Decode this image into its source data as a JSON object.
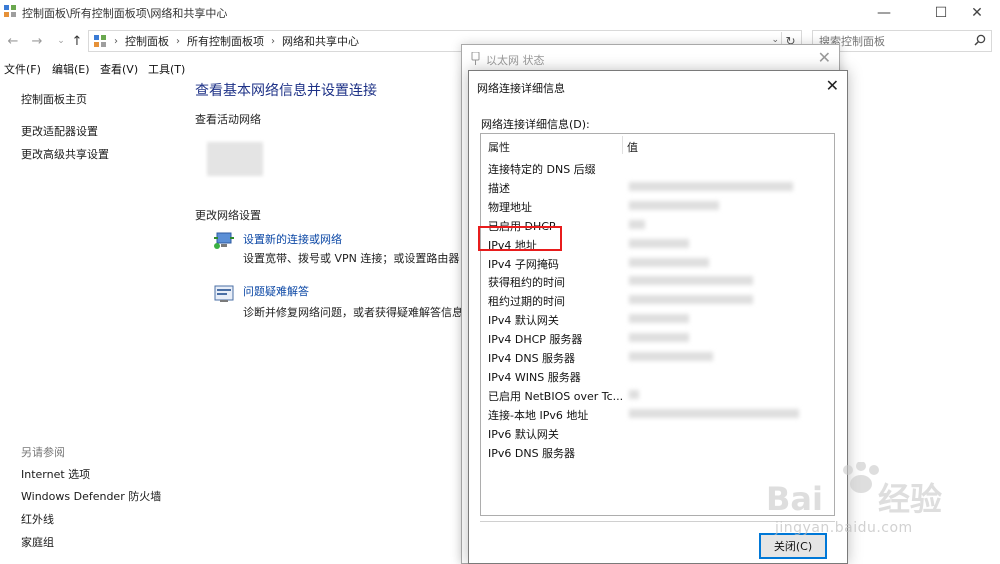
{
  "window": {
    "title": "控制面板\\所有控制面板项\\网络和共享中心",
    "minimize": "—",
    "maximize": "☐",
    "close": "✕"
  },
  "address": {
    "back": "←",
    "forward": "→",
    "up": "↑",
    "crumbs": [
      "控制面板",
      "所有控制面板项",
      "网络和共享中心"
    ],
    "dropdown": "⌄",
    "refresh": "↻",
    "search_placeholder": "搜索控制面板"
  },
  "menubar": [
    "文件(F)",
    "编辑(E)",
    "查看(V)",
    "工具(T)"
  ],
  "sidebar": {
    "home": "控制面板主页",
    "links": [
      "更改适配器设置",
      "更改高级共享设置"
    ],
    "see_also": "另请参阅",
    "see_also_links": [
      "Internet 选项",
      "Windows Defender 防火墙",
      "红外线",
      "家庭组"
    ]
  },
  "main": {
    "title": "查看基本网络信息并设置连接",
    "active_networks": "查看活动网络",
    "change_settings": "更改网络设置",
    "tasks": [
      {
        "link": "设置新的连接或网络",
        "desc": "设置宽带、拨号或 VPN 连接；或设置路由器"
      },
      {
        "link": "问题疑难解答",
        "desc": "诊断并修复网络问题，或者获得疑难解答信息。"
      }
    ]
  },
  "eth_window": {
    "title": "以太网 状态",
    "close": "✕"
  },
  "dialog": {
    "title": "网络连接详细信息",
    "close": "✕",
    "label": "网络连接详细信息(D):",
    "col_property": "属性",
    "col_value": "值",
    "rows": [
      {
        "property": "连接特定的 DNS 后缀",
        "blur": 0
      },
      {
        "property": "描述",
        "blur": 0.82
      },
      {
        "property": "物理地址",
        "blur": 0.45
      },
      {
        "property": "已启用 DHCP",
        "blur": 0.08
      },
      {
        "property": "IPv4 地址",
        "blur": 0.3
      },
      {
        "property": "IPv4 子网掩码",
        "blur": 0.4
      },
      {
        "property": "获得租约的时间",
        "blur": 0.62
      },
      {
        "property": "租约过期的时间",
        "blur": 0.62
      },
      {
        "property": "IPv4 默认网关",
        "blur": 0.3
      },
      {
        "property": "IPv4 DHCP 服务器",
        "blur": 0.3
      },
      {
        "property": "IPv4 DNS 服务器",
        "blur": 0.42
      },
      {
        "property": "IPv4 WINS 服务器",
        "blur": 0
      },
      {
        "property": "已启用 NetBIOS over Tc...",
        "blur": 0.05
      },
      {
        "property": "连接-本地 IPv6 地址",
        "blur": 0.85
      },
      {
        "property": "IPv6 默认网关",
        "blur": 0
      },
      {
        "property": "IPv6 DNS 服务器",
        "blur": 0
      }
    ],
    "close_button": "关闭(C)"
  }
}
